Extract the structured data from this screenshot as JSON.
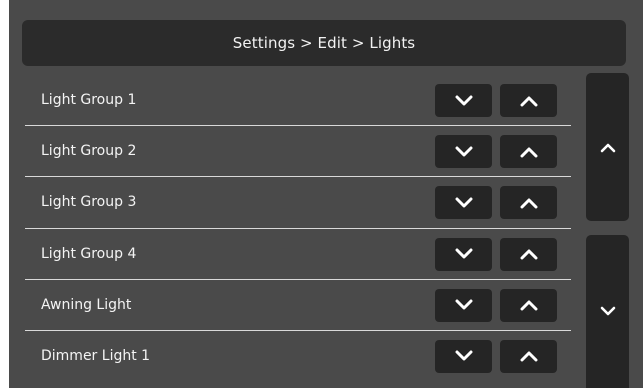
{
  "header": {
    "breadcrumb": "Settings > Edit > Lights"
  },
  "lights": [
    {
      "label": "Light Group 1",
      "down_icon": "chevron-down-icon",
      "up_icon": "chevron-up-icon"
    },
    {
      "label": "Light Group 2",
      "down_icon": "chevron-down-icon",
      "up_icon": "chevron-up-icon"
    },
    {
      "label": "Light Group 3",
      "down_icon": "chevron-down-icon",
      "up_icon": "chevron-up-icon"
    },
    {
      "label": "Light Group 4",
      "down_icon": "chevron-down-icon",
      "up_icon": "chevron-up-icon"
    },
    {
      "label": "Awning Light",
      "down_icon": "chevron-down-icon",
      "up_icon": "chevron-up-icon"
    },
    {
      "label": "Dimmer Light 1",
      "down_icon": "chevron-down-icon",
      "up_icon": "chevron-up-icon"
    }
  ],
  "scroll": {
    "up_icon": "chevron-up-icon",
    "down_icon": "chevron-down-icon"
  },
  "colors": {
    "background": "#4a4a4a",
    "header": "#2b2b2b",
    "button": "#252525",
    "text": "#f4f4f4",
    "divider": "#d9d9d9"
  }
}
